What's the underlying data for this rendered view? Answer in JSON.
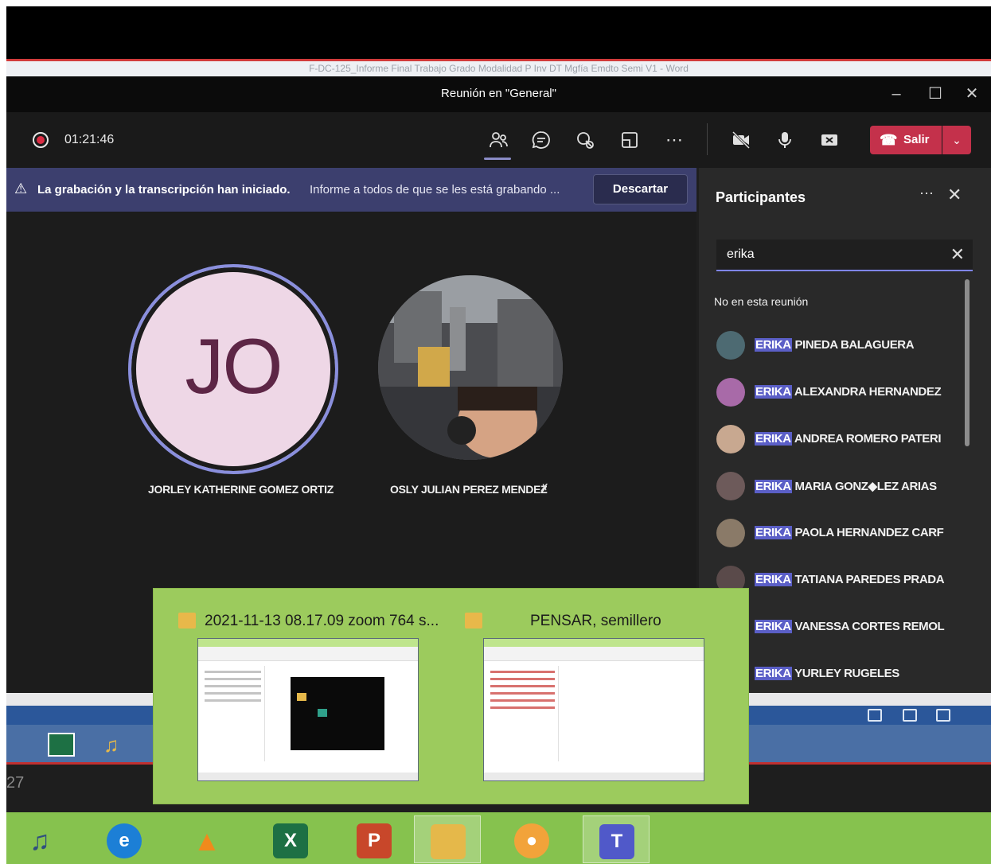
{
  "word": {
    "title": "F-DC-125_Informe Final Trabajo Grado Modalidad P Inv DT Mgfía Emdto Semi V1 - Word"
  },
  "teams": {
    "window_title": "Reunión en \"General\"",
    "recording_time": "01:21:46",
    "leave_label": "Salir",
    "banner": {
      "bold": "La grabación y la transcripción han iniciado.",
      "text": "Informe a todos de que se les está grabando ...",
      "dismiss": "Descartar"
    },
    "stage": {
      "tiles": [
        {
          "initials": "JO",
          "name": "JORLEY KATHERINE GOMEZ ORTIZ"
        },
        {
          "name": "OSLY JULIAN PEREZ MENDEZ"
        }
      ]
    },
    "participants": {
      "title": "Participantes",
      "search_value": "erika",
      "section": "No en esta reunión",
      "highlight": "ERIKA",
      "people": [
        {
          "rest": "PINEDA BALAGUERA",
          "avatar": "#4d6a72"
        },
        {
          "rest": "ALEXANDRA HERNANDEZ",
          "avatar": "#a86aa8"
        },
        {
          "rest": "ANDREA ROMERO PATERI",
          "avatar": "#c8a890"
        },
        {
          "rest": "MARIA GONZ◆LEZ ARIAS",
          "avatar": "#6d5a5a"
        },
        {
          "rest": "PAOLA HERNANDEZ CARF",
          "avatar": "#8a7a68"
        },
        {
          "rest": "TATIANA PAREDES PRADA",
          "avatar": "#5a4a4a"
        },
        {
          "rest": "VANESSA CORTES REMOL",
          "avatar": ""
        },
        {
          "rest": "YURLEY RUGELES",
          "avatar": ""
        }
      ]
    }
  },
  "explorer_thumbs": [
    {
      "title": "2021-11-13 08.17.09 zoom 764 s..."
    },
    {
      "title": "PENSAR, semillero"
    }
  ],
  "background_text": {
    "left_number": "27"
  },
  "taskbar_apps": [
    {
      "name": "music-app",
      "label": "♫",
      "color": "#2f4f7f"
    },
    {
      "name": "edge",
      "label": "e",
      "color": "#1c7fd6"
    },
    {
      "name": "vlc",
      "label": "▲",
      "color": "#f08a1c"
    },
    {
      "name": "excel",
      "label": "X",
      "color": "#1d7044"
    },
    {
      "name": "powerpoint",
      "label": "P",
      "color": "#c8472a"
    },
    {
      "name": "file-explorer",
      "label": "▭",
      "color": "#e5b84a"
    },
    {
      "name": "vpn",
      "label": "◔",
      "color": "#f2a33a"
    },
    {
      "name": "teams",
      "label": "T",
      "color": "#5059c9"
    }
  ]
}
